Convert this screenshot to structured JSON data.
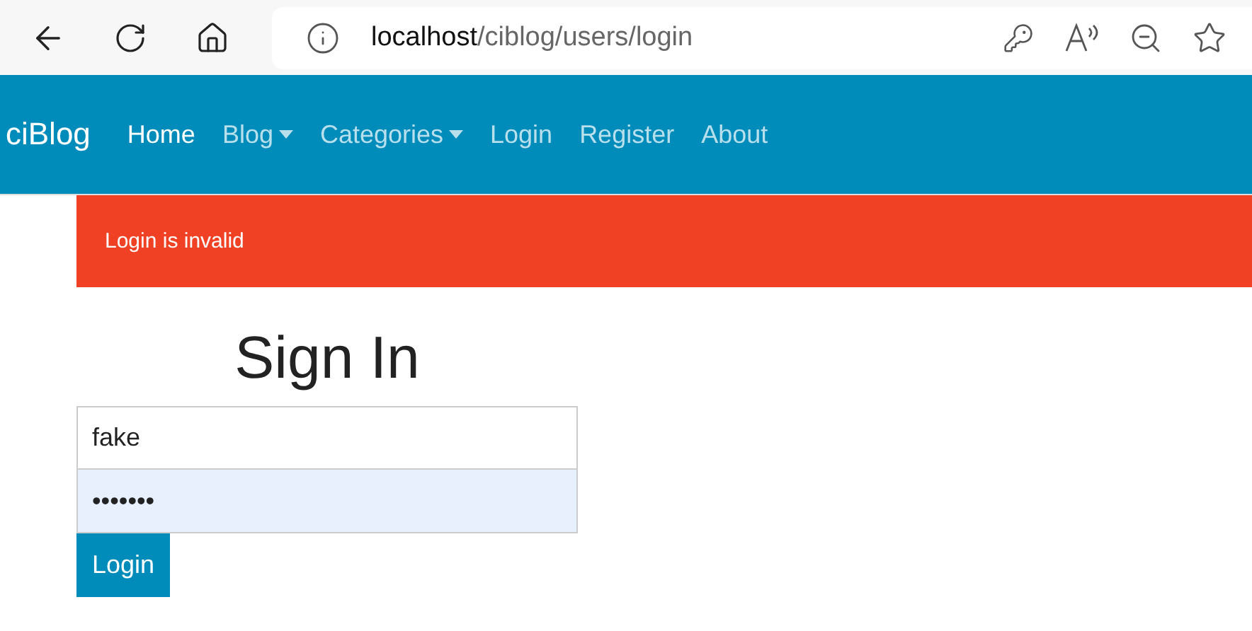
{
  "browser": {
    "url": {
      "host": "localhost",
      "path": "/ciblog/users/login"
    }
  },
  "navbar": {
    "brand": "ciBlog",
    "items": [
      {
        "label": "Home",
        "selected": true,
        "dropdown": false
      },
      {
        "label": "Blog",
        "selected": false,
        "dropdown": true
      },
      {
        "label": "Categories",
        "selected": false,
        "dropdown": true
      },
      {
        "label": "Login",
        "selected": false,
        "dropdown": false
      },
      {
        "label": "Register",
        "selected": false,
        "dropdown": false
      },
      {
        "label": "About",
        "selected": false,
        "dropdown": false
      }
    ]
  },
  "alert": {
    "message": "Login is invalid"
  },
  "form": {
    "title": "Sign In",
    "username": {
      "value": "fake"
    },
    "password": {
      "value": "•••••••",
      "autofilled": true
    },
    "submit": "Login"
  }
}
